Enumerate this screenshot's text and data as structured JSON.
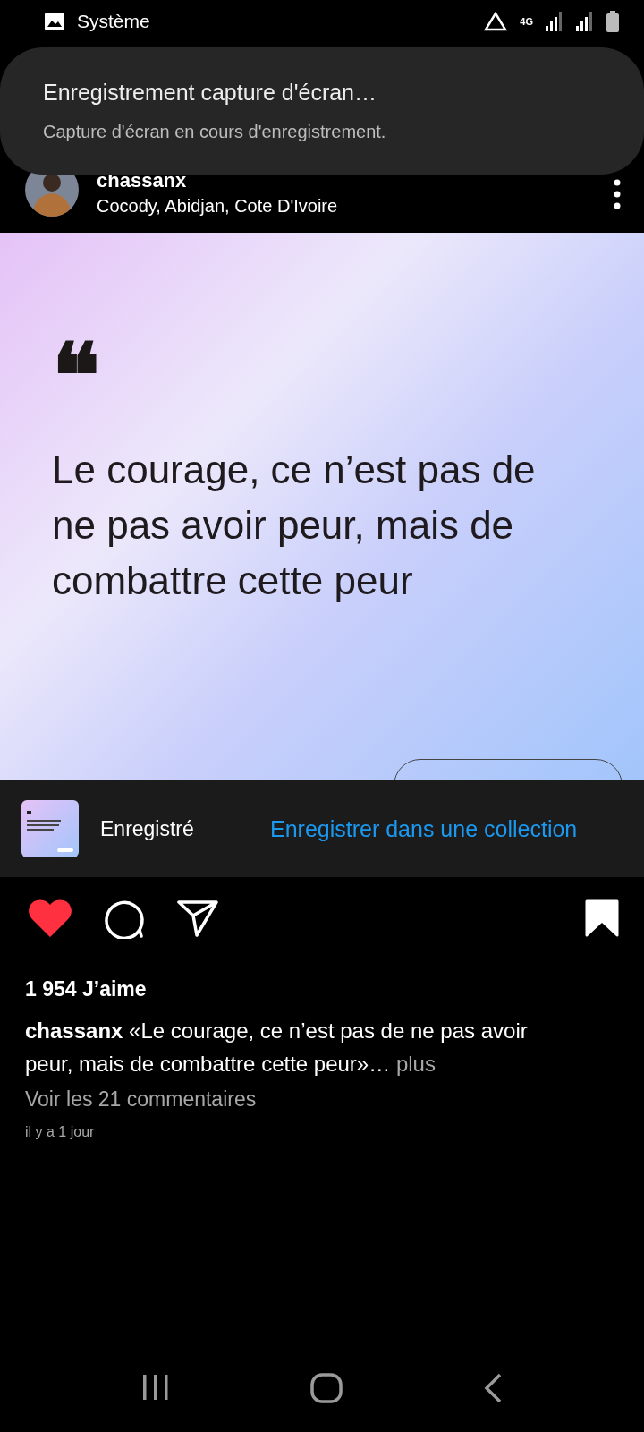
{
  "status_bar": {
    "app_label": "Système",
    "network": "4G"
  },
  "notification": {
    "title": "Enregistrement capture d'écran…",
    "message": "Capture d'écran en cours d'enregistrement."
  },
  "post_header": {
    "username": "chassanx",
    "location": "Cocody, Abidjan, Cote D'Ivoire"
  },
  "post_image": {
    "quote_mark": "❝",
    "quote": "Le courage, ce n’est pas de ne pas avoir peur, mais de combattre cette peur"
  },
  "saved_toast": {
    "label": "Enregistré",
    "action": "Enregistrer dans une collection"
  },
  "actions": {
    "liked": true,
    "saved": true
  },
  "likes": "1 954 J’aime",
  "caption": {
    "username": "chassanx",
    "text": "«Le courage, ce n’est pas de ne pas avoir peur, mais de combattre cette peur»",
    "ellipsis": "…",
    "more": "plus"
  },
  "comments_link": "Voir les 21 commentaires",
  "timestamp": "il y a 1 jour"
}
